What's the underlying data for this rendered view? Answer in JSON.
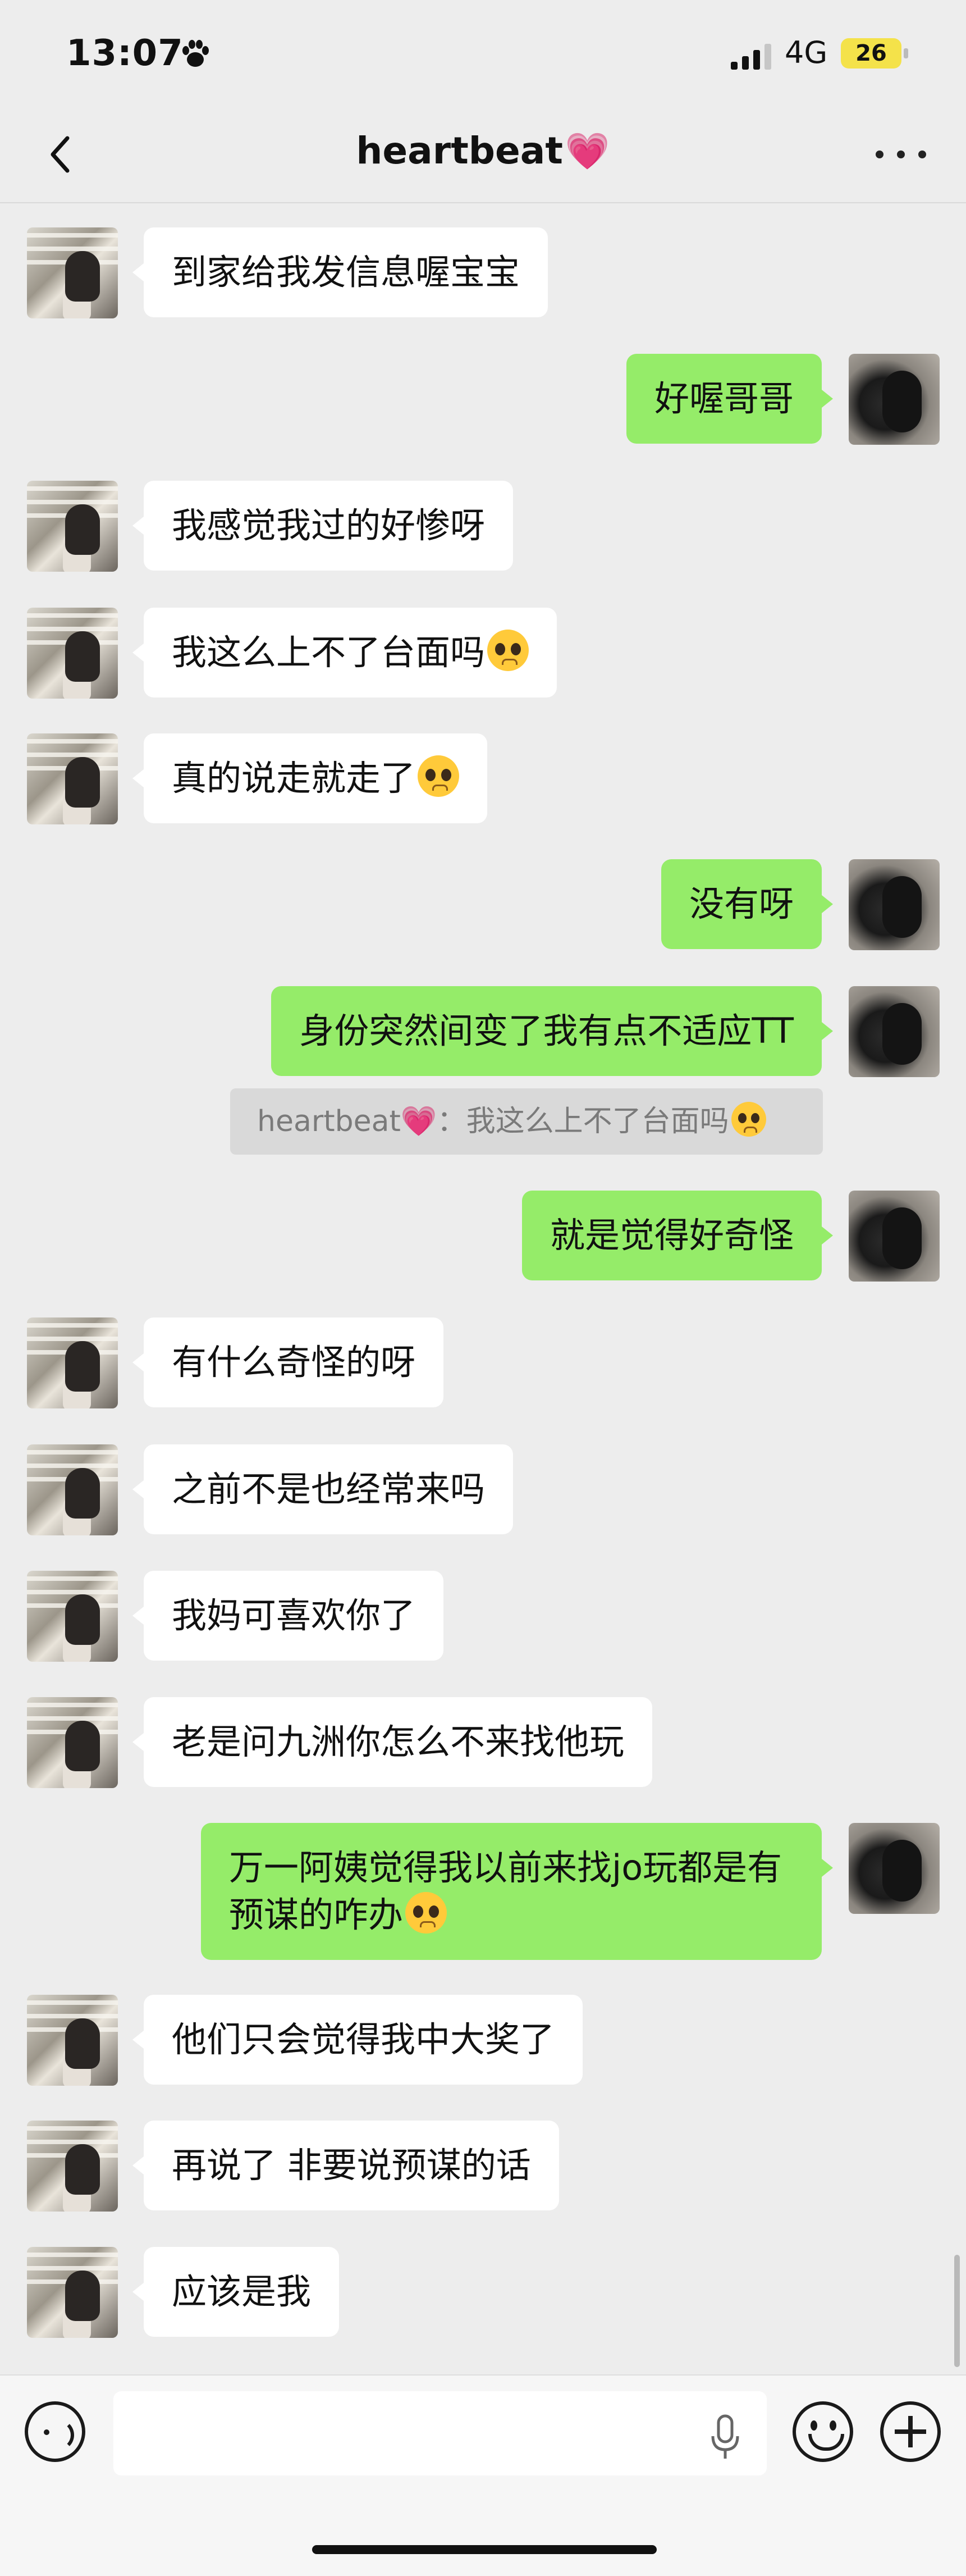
{
  "status_bar": {
    "time": "13:07",
    "network": "4G",
    "battery": "26"
  },
  "header": {
    "title": "heartbeat",
    "title_emoji": "💗"
  },
  "messages": [
    {
      "side": "left",
      "text": "到家给我发信息喔宝宝"
    },
    {
      "side": "right",
      "text": "好喔哥哥"
    },
    {
      "side": "left",
      "text": "我感觉我过的好惨呀"
    },
    {
      "side": "left",
      "text": "我这么上不了台面吗",
      "emoji": "pleading-face"
    },
    {
      "side": "left",
      "text": "真的说走就走了",
      "emoji": "pleading-face"
    },
    {
      "side": "right",
      "text": "没有呀"
    },
    {
      "side": "right",
      "text": "身份突然间变了我有点不适应TT"
    },
    {
      "side": "right",
      "text": "就是觉得好奇怪"
    },
    {
      "side": "left",
      "text": "有什么奇怪的呀"
    },
    {
      "side": "left",
      "text": "之前不是也经常来吗"
    },
    {
      "side": "left",
      "text": "我妈可喜欢你了"
    },
    {
      "side": "left",
      "text": "老是问九洲你怎么不来找他玩"
    },
    {
      "side": "right",
      "line1": "万一阿姨觉得我以前来找jo玩都是有",
      "line2": "预谋的咋办",
      "emoji": "crying-face"
    },
    {
      "side": "left",
      "text": "他们只会觉得我中大奖了"
    },
    {
      "side": "left",
      "text": "再说了 非要说预谋的话"
    },
    {
      "side": "left",
      "text": "应该是我"
    }
  ],
  "quote": {
    "sender": "heartbeat💗",
    "separator": "：",
    "text": "我这么上不了台面吗",
    "emoji": "pleading-face"
  },
  "input": {
    "placeholder": ""
  },
  "icons": {
    "back": "chevron-left-icon",
    "more": "more-dots-icon",
    "voice": "voice-icon",
    "mic": "microphone-icon",
    "emoji": "smiley-icon",
    "add": "plus-icon",
    "paw": "paw-icon"
  },
  "colors": {
    "sent_bubble": "#95ec69",
    "received_bubble": "#ffffff",
    "background": "#ededed",
    "heart": "#ff4f9c"
  }
}
